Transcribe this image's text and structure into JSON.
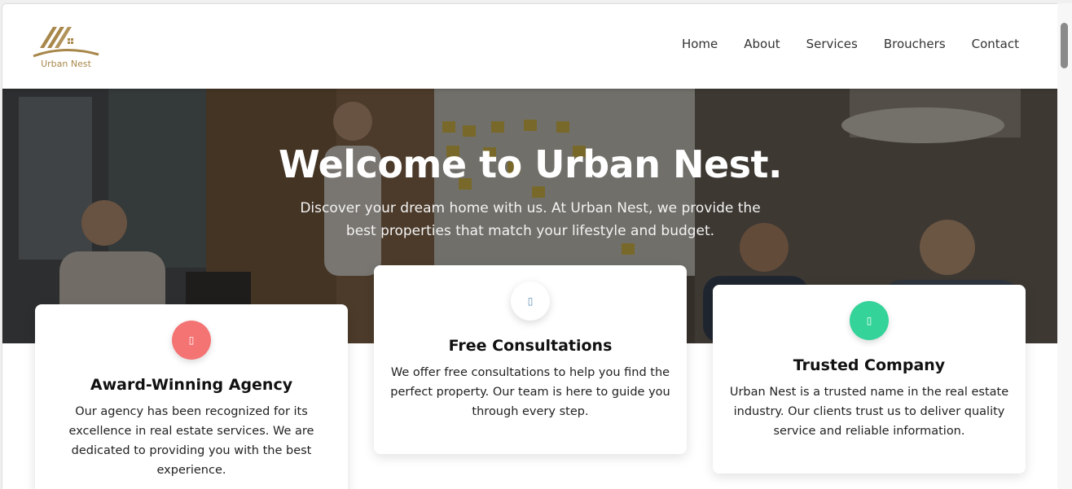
{
  "brand": {
    "name": "Urban Nest",
    "accent_color": "#a8874a"
  },
  "nav": {
    "items": [
      {
        "label": "Home"
      },
      {
        "label": "About"
      },
      {
        "label": "Services"
      },
      {
        "label": "Brouchers"
      },
      {
        "label": "Contact"
      }
    ]
  },
  "hero": {
    "title": "Welcome to Urban Nest.",
    "subtitle": "Discover your dream home with us. At Urban Nest, we provide the best properties that match your lifestyle and budget."
  },
  "features": [
    {
      "icon": "award-icon",
      "icon_glyph": "▯",
      "icon_color": "#f47373",
      "title": "Award-Winning Agency",
      "text": "Our agency has been recognized for its excellence in real estate services. We are dedicated to providing you with the best experience."
    },
    {
      "icon": "consultation-icon",
      "icon_glyph": "▯",
      "icon_color": "#ffffff",
      "title": "Free Consultations",
      "text": "We offer free consultations to help you find the perfect property. Our team is here to guide you through every step."
    },
    {
      "icon": "trusted-icon",
      "icon_glyph": "▯",
      "icon_color": "#34d399",
      "title": "Trusted Company",
      "text": "Urban Nest is a trusted name in the real estate industry. Our clients trust us to deliver quality service and reliable information."
    }
  ]
}
